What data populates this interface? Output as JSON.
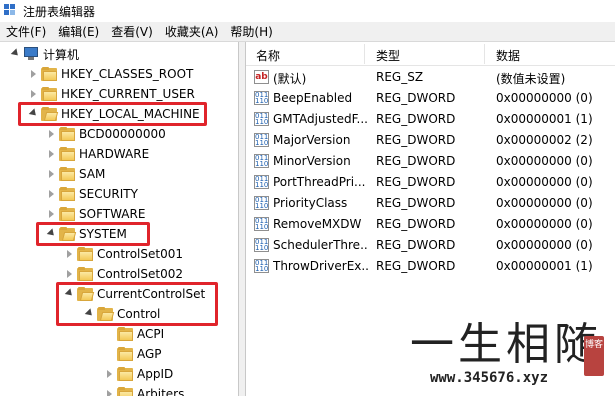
{
  "window": {
    "title": "注册表编辑器"
  },
  "menu": [
    "文件(F)",
    "编辑(E)",
    "查看(V)",
    "收藏夹(A)",
    "帮助(H)"
  ],
  "tree": [
    {
      "label": "计算机",
      "icon": "computer-icon",
      "arrow": "down",
      "depth": 0
    },
    {
      "label": "HKEY_CLASSES_ROOT",
      "icon": "folder-icon",
      "arrow": "right",
      "depth": 1
    },
    {
      "label": "HKEY_CURRENT_USER",
      "icon": "folder-icon",
      "arrow": "right",
      "depth": 1
    },
    {
      "label": "HKEY_LOCAL_MACHINE",
      "icon": "folder-open-icon",
      "arrow": "down",
      "depth": 1
    },
    {
      "label": "BCD00000000",
      "icon": "folder-icon",
      "arrow": "right",
      "depth": 2
    },
    {
      "label": "HARDWARE",
      "icon": "folder-icon",
      "arrow": "right",
      "depth": 2
    },
    {
      "label": "SAM",
      "icon": "folder-icon",
      "arrow": "right",
      "depth": 2
    },
    {
      "label": "SECURITY",
      "icon": "folder-icon",
      "arrow": "right",
      "depth": 2
    },
    {
      "label": "SOFTWARE",
      "icon": "folder-icon",
      "arrow": "right",
      "depth": 2
    },
    {
      "label": "SYSTEM",
      "icon": "folder-open-icon",
      "arrow": "down",
      "depth": 2
    },
    {
      "label": "ControlSet001",
      "icon": "folder-icon",
      "arrow": "right",
      "depth": 3
    },
    {
      "label": "ControlSet002",
      "icon": "folder-icon",
      "arrow": "right",
      "depth": 3
    },
    {
      "label": "CurrentControlSet",
      "icon": "folder-open-icon",
      "arrow": "down",
      "depth": 3
    },
    {
      "label": "Control",
      "icon": "folder-open-icon",
      "arrow": "down",
      "depth": 4
    },
    {
      "label": "ACPI",
      "icon": "folder-icon",
      "arrow": "none",
      "depth": 5
    },
    {
      "label": "AGP",
      "icon": "folder-icon",
      "arrow": "none",
      "depth": 5
    },
    {
      "label": "AppID",
      "icon": "folder-icon",
      "arrow": "right",
      "depth": 5
    },
    {
      "label": "Arbiters",
      "icon": "folder-icon",
      "arrow": "right",
      "depth": 5
    }
  ],
  "list": {
    "columns": [
      "名称",
      "类型",
      "数据"
    ],
    "rows": [
      {
        "name": "(默认)",
        "type": "REG_SZ",
        "data": "(数值未设置)",
        "icon": "string-value-icon"
      },
      {
        "name": "BeepEnabled",
        "type": "REG_DWORD",
        "data": "0x00000000 (0)",
        "icon": "dword-value-icon"
      },
      {
        "name": "GMTAdjustedF...",
        "type": "REG_DWORD",
        "data": "0x00000001 (1)",
        "icon": "dword-value-icon"
      },
      {
        "name": "MajorVersion",
        "type": "REG_DWORD",
        "data": "0x00000002 (2)",
        "icon": "dword-value-icon"
      },
      {
        "name": "MinorVersion",
        "type": "REG_DWORD",
        "data": "0x00000000 (0)",
        "icon": "dword-value-icon"
      },
      {
        "name": "PortThreadPri...",
        "type": "REG_DWORD",
        "data": "0x00000000 (0)",
        "icon": "dword-value-icon"
      },
      {
        "name": "PriorityClass",
        "type": "REG_DWORD",
        "data": "0x00000000 (0)",
        "icon": "dword-value-icon"
      },
      {
        "name": "RemoveMXDW",
        "type": "REG_DWORD",
        "data": "0x00000000 (0)",
        "icon": "dword-value-icon"
      },
      {
        "name": "SchedulerThre...",
        "type": "REG_DWORD",
        "data": "0x00000000 (0)",
        "icon": "dword-value-icon"
      },
      {
        "name": "ThrowDriverEx...",
        "type": "REG_DWORD",
        "data": "0x00000001 (1)",
        "icon": "dword-value-icon"
      }
    ]
  },
  "watermark": {
    "script": "一生相随",
    "url": "www.345676.xyz",
    "seal": "博客"
  },
  "colors": {
    "highlight": "#e0242b",
    "folder": "#f3c957"
  }
}
